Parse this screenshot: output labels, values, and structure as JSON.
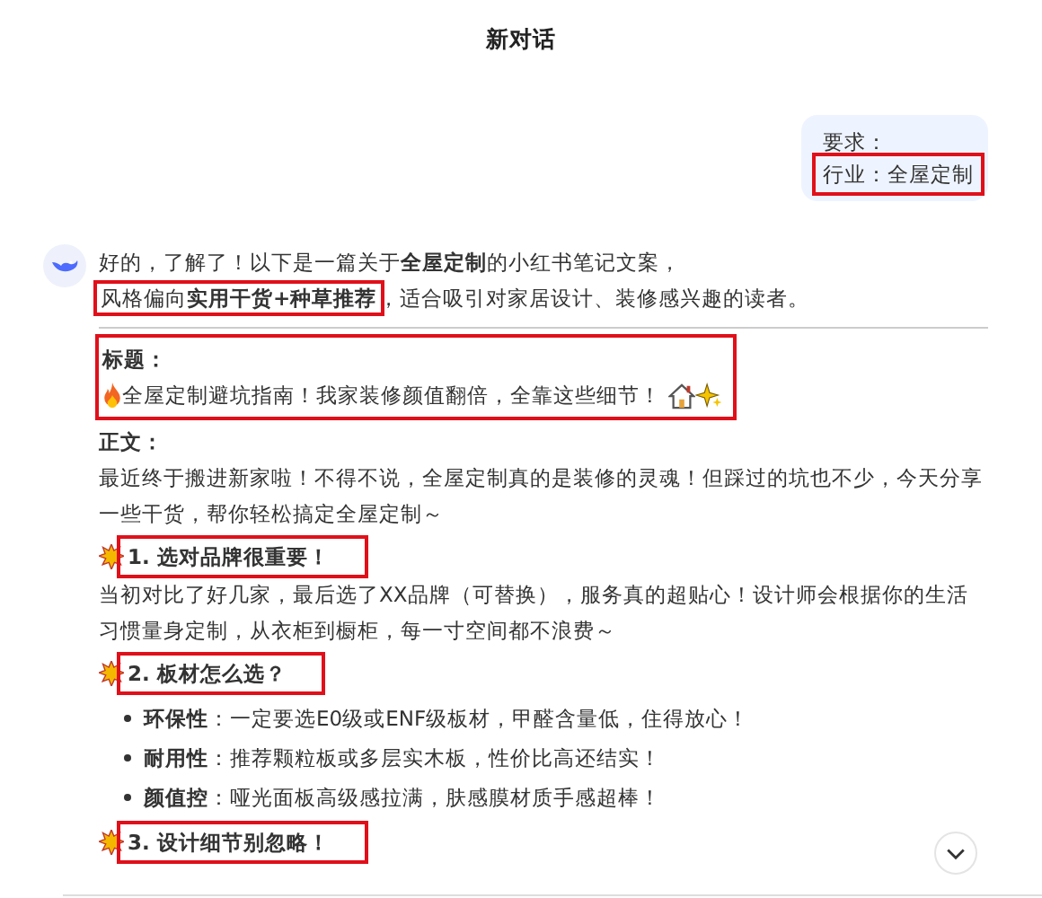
{
  "window": {
    "title": "新对话"
  },
  "user_message": {
    "lines": [
      {
        "text": "要求：",
        "highlighted": false
      },
      {
        "text": "行业：全屋定制",
        "highlighted": true
      }
    ]
  },
  "reply": {
    "intro": [
      {
        "text": "好的，了解了！以下是一篇关于**全屋定制**的小红书笔记文案，",
        "highlighted": false
      },
      {
        "text": "风格偏向**实用干货+种草推荐**",
        "highlighted": true
      },
      {
        "text": "，适合吸引对家居设计、装修感兴趣的读者。",
        "highlighted": false
      }
    ],
    "title_block": {
      "label": "标题：",
      "text": "全屋定制避坑指南！我家装修颜值翻倍，全靠这些细节！",
      "highlighted": true
    },
    "body_label": "正文：",
    "body": "最近终于搬进新家啦！不得不说，全屋定制真的是装修的灵魂！但踩过的坑也不少，今天分享一些干货，帮你轻松搞定全屋定制～",
    "sections": [
      {
        "heading": "1. 选对品牌很重要！",
        "highlighted": true,
        "text": "当初对比了好几家，最后选了XX品牌（可替换），服务真的超贴心！设计师会根据你的生活习惯量身定制，从衣柜到橱柜，每一寸空间都不浪费～"
      },
      {
        "heading": "2. 板材怎么选？",
        "highlighted": true,
        "bullets": [
          {
            "term": "环保性",
            "text": "：一定要选E0级或ENF级板材，甲醛含量低，住得放心！"
          },
          {
            "term": "耐用性",
            "text": "：推荐颗粒板或多层实木板，性价比高还结实！"
          },
          {
            "term": "颜值控",
            "text": "：哑光面板高级感拉满，肤感膜材质手感超棒！"
          }
        ]
      },
      {
        "heading": "3. 设计细节别忽略！",
        "highlighted": true
      }
    ]
  }
}
